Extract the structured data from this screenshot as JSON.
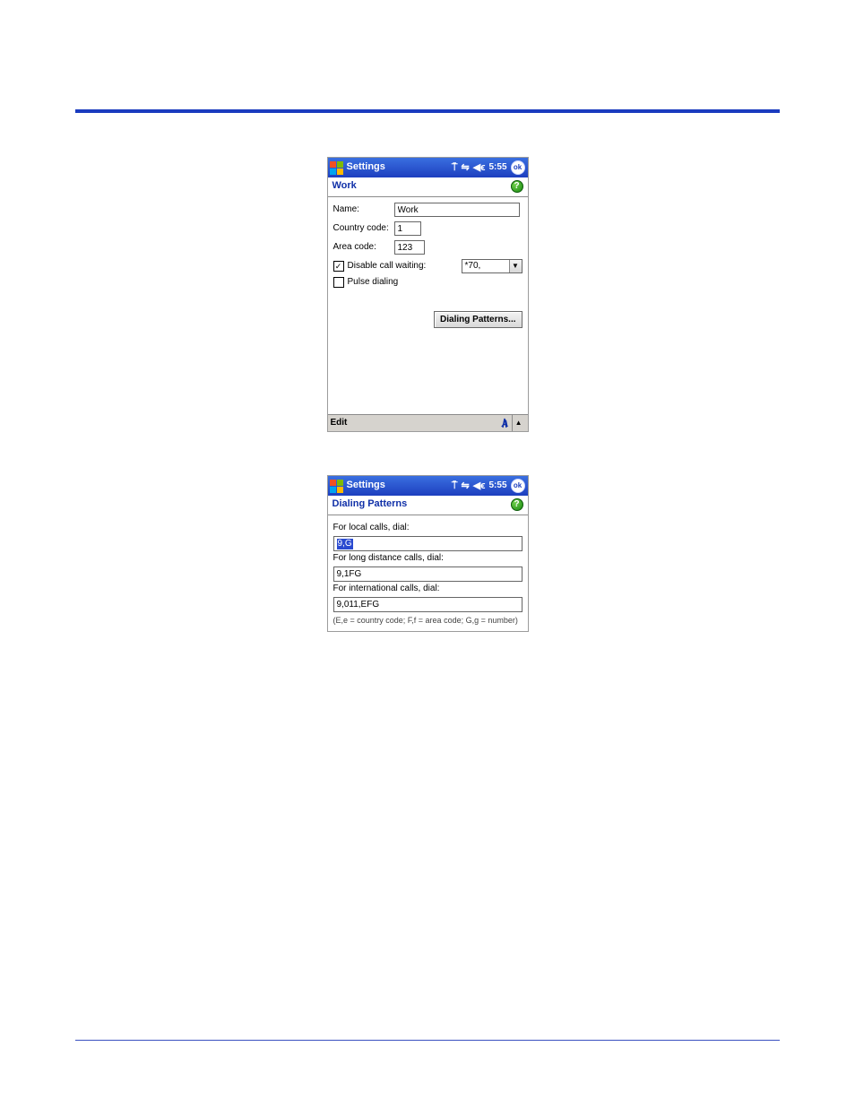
{
  "titlebar": {
    "app_title": "Settings",
    "time": "5:55",
    "ok_label": "ok"
  },
  "screen1": {
    "subtitle": "Work",
    "name_label": "Name:",
    "name_value": "Work",
    "country_label": "Country code:",
    "country_value": "1",
    "area_label": "Area code:",
    "area_value": "123",
    "disable_cw_label": "Disable call waiting:",
    "disable_cw_checked": true,
    "cw_code": "*70,",
    "pulse_label": "Pulse dialing",
    "pulse_checked": false,
    "dp_button": "Dialing Patterns...",
    "menu_edit": "Edit"
  },
  "screen2": {
    "subtitle": "Dialing Patterns",
    "local_label": "For local calls, dial:",
    "local_value": "9,G",
    "long_label": "For long distance calls, dial:",
    "long_value": "9,1FG",
    "intl_label": "For international calls, dial:",
    "intl_value": "9,011,EFG",
    "legend": "(E,e = country code; F,f = area code; G,g = number)"
  }
}
